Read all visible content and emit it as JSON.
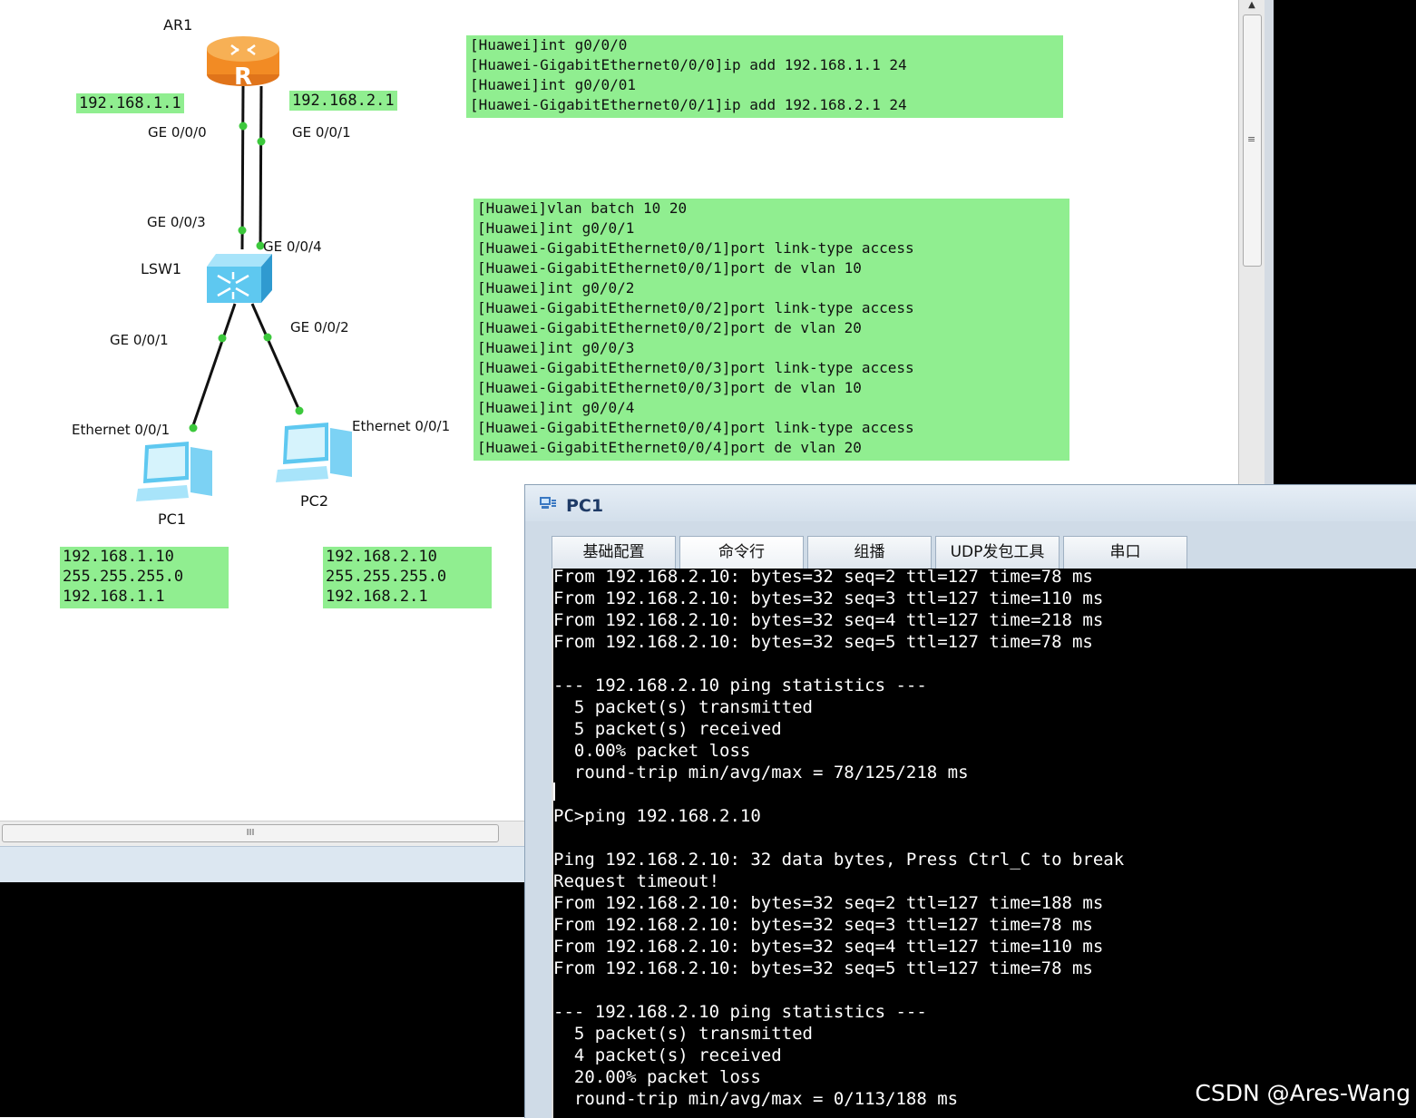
{
  "topology": {
    "router": {
      "name": "AR1",
      "icon_letter": "R",
      "if_left": "GE 0/0/0",
      "if_right": "GE 0/0/1",
      "ip_left": "192.168.1.1",
      "ip_right": "192.168.2.1"
    },
    "switch": {
      "name": "LSW1",
      "if_up_left": "GE 0/0/3",
      "if_up_right": "GE 0/0/4",
      "if_down_left": "GE 0/0/1",
      "if_down_right": "GE 0/0/2"
    },
    "pc1": {
      "name": "PC1",
      "interface": "Ethernet 0/0/1",
      "ip": "192.168.1.10",
      "mask": "255.255.255.0",
      "gateway": "192.168.1.1"
    },
    "pc2": {
      "name": "PC2",
      "interface": "Ethernet 0/0/1",
      "ip": "192.168.2.10",
      "mask": "255.255.255.0",
      "gateway": "192.168.2.1"
    }
  },
  "router_config": [
    "[Huawei]int g0/0/0",
    "[Huawei-GigabitEthernet0/0/0]ip add 192.168.1.1 24",
    "[Huawei]int g0/0/01",
    "[Huawei-GigabitEthernet0/0/1]ip add 192.168.2.1 24"
  ],
  "switch_config": [
    "[Huawei]vlan batch 10 20",
    "[Huawei]int g0/0/1",
    "[Huawei-GigabitEthernet0/0/1]port link-type access",
    "[Huawei-GigabitEthernet0/0/1]port de vlan 10",
    "[Huawei]int g0/0/2",
    "[Huawei-GigabitEthernet0/0/2]port link-type access",
    "[Huawei-GigabitEthernet0/0/2]port de vlan 20",
    "[Huawei]int g0/0/3",
    "[Huawei-GigabitEthernet0/0/3]port link-type access",
    "[Huawei-GigabitEthernet0/0/3]port de vlan 10",
    "[Huawei]int g0/0/4",
    "[Huawei-GigabitEthernet0/0/4]port link-type access",
    "[Huawei-GigabitEthernet0/0/4]port de vlan 20"
  ],
  "hscroll_grip": "III",
  "vscroll_grip": "≡",
  "pc_window": {
    "title": "PC1",
    "tabs": [
      "基础配置",
      "命令行",
      "组播",
      "UDP发包工具",
      "串口"
    ],
    "terminal_lines": [
      "From 192.168.2.10: bytes=32 seq=2 ttl=127 time=78 ms",
      "From 192.168.2.10: bytes=32 seq=3 ttl=127 time=110 ms",
      "From 192.168.2.10: bytes=32 seq=4 ttl=127 time=218 ms",
      "From 192.168.2.10: bytes=32 seq=5 ttl=127 time=78 ms",
      "",
      "--- 192.168.2.10 ping statistics ---",
      "  5 packet(s) transmitted",
      "  5 packet(s) received",
      "  0.00% packet loss",
      "  round-trip min/avg/max = 78/125/218 ms",
      "",
      "PC>ping 192.168.2.10",
      "",
      "Ping 192.168.2.10: 32 data bytes, Press Ctrl_C to break",
      "Request timeout!",
      "From 192.168.2.10: bytes=32 seq=2 ttl=127 time=188 ms",
      "From 192.168.2.10: bytes=32 seq=3 ttl=127 time=78 ms",
      "From 192.168.2.10: bytes=32 seq=4 ttl=127 time=110 ms",
      "From 192.168.2.10: bytes=32 seq=5 ttl=127 time=78 ms",
      "",
      "--- 192.168.2.10 ping statistics ---",
      "  5 packet(s) transmitted",
      "  4 packet(s) received",
      "  20.00% packet loss",
      "  round-trip min/avg/max = 0/113/188 ms"
    ]
  },
  "watermark": "CSDN @Ares-Wang",
  "colors": {
    "highlight": "#90ee90",
    "link_dot": "#3cc83c",
    "terminal_bg": "#000000",
    "router": "#f59a2c",
    "device_blue": "#5ec8f0"
  }
}
